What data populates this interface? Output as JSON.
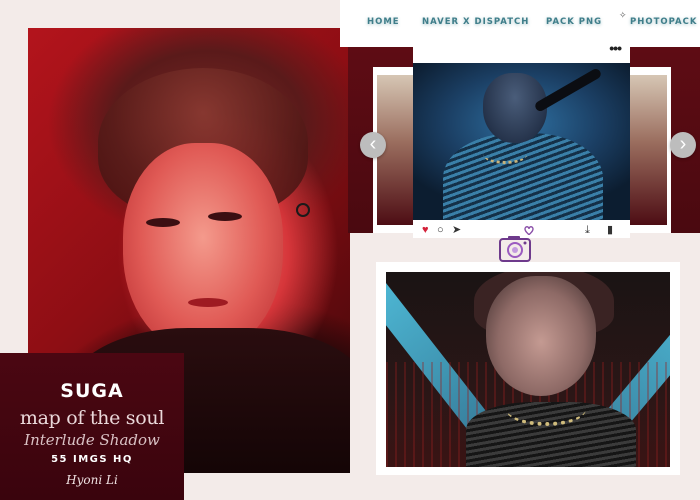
{
  "nav": {
    "items": [
      "HOME",
      "NAVER X DISPATCH",
      "PACK PNG",
      "PHOTOPACK"
    ]
  },
  "carousel": {
    "prev_icon": "chevron-left-icon",
    "next_icon": "chevron-right-icon",
    "prev_glyph": "‹",
    "next_glyph": "›"
  },
  "post": {
    "menu_glyph": "•••",
    "actions": {
      "heart": "♥",
      "comment": "○",
      "share": "➤",
      "download": "⤓",
      "bookmark": "▮"
    }
  },
  "title_panel": {
    "name": "SUGA",
    "album": "map of the soul",
    "track": "Interlude Shadow",
    "count": "55 IMGS HQ",
    "signature": "Hyoni Li"
  },
  "colors": {
    "accent_teal": "#3f7e8a",
    "maroon": "#4b0712",
    "heart": "#d4213a"
  }
}
